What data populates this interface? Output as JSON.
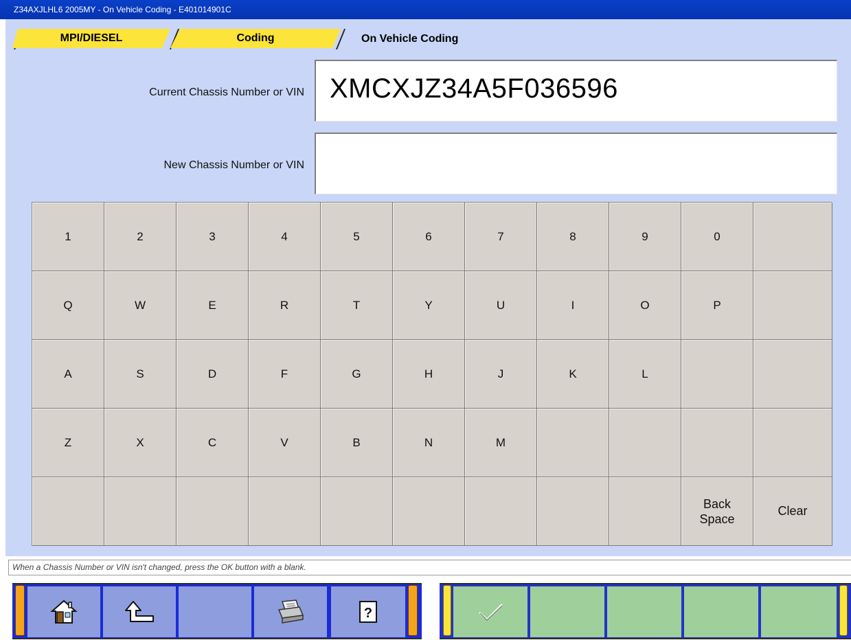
{
  "window": {
    "title_parts": [
      "Z34AXJLHL6 2005MY",
      " - ",
      "On Vehicle Coding",
      " - ",
      "E401014901C"
    ]
  },
  "tabs": {
    "items": [
      {
        "label": "MPI/DIESEL"
      },
      {
        "label": "Coding"
      },
      {
        "label": "On Vehicle Coding"
      }
    ]
  },
  "form": {
    "current_label": "Current Chassis Number or VIN",
    "current_value": "XMCXJZ34A5F036596",
    "new_label": "New Chassis Number or VIN",
    "new_value": ""
  },
  "keypad": {
    "rows": [
      [
        "1",
        "2",
        "3",
        "4",
        "5",
        "6",
        "7",
        "8",
        "9",
        "0",
        ""
      ],
      [
        "Q",
        "W",
        "E",
        "R",
        "T",
        "Y",
        "U",
        "I",
        "O",
        "P",
        ""
      ],
      [
        "A",
        "S",
        "D",
        "F",
        "G",
        "H",
        "J",
        "K",
        "L",
        "",
        ""
      ],
      [
        "Z",
        "X",
        "C",
        "V",
        "B",
        "N",
        "M",
        "",
        "",
        "",
        ""
      ],
      [
        "",
        "",
        "",
        "",
        "",
        "",
        "",
        "",
        "",
        "Back\nSpace",
        "Clear"
      ]
    ]
  },
  "hint": {
    "text": "When a Chassis Number or VIN isn't changed, press the OK button with a blank."
  },
  "toolbar": {
    "left_icons": [
      "home-icon",
      "back-arrow-icon",
      "",
      "printer-icon",
      "help-icon"
    ],
    "right_icons": [
      "checkmark-icon",
      "",
      "",
      "",
      ""
    ],
    "colors": {
      "left_bg": "#8e9ddd",
      "right_bg": "#9fcf9a",
      "frame_blue": "#1a2bd6",
      "orange_cap": "#f5a31a",
      "yellow_cap": "#fde43a"
    }
  },
  "colors": {
    "titlebar": "#0a3fc8",
    "panel": "#c9d6f7",
    "tab_active": "#fde43a",
    "key_face": "#d7d3cc"
  }
}
